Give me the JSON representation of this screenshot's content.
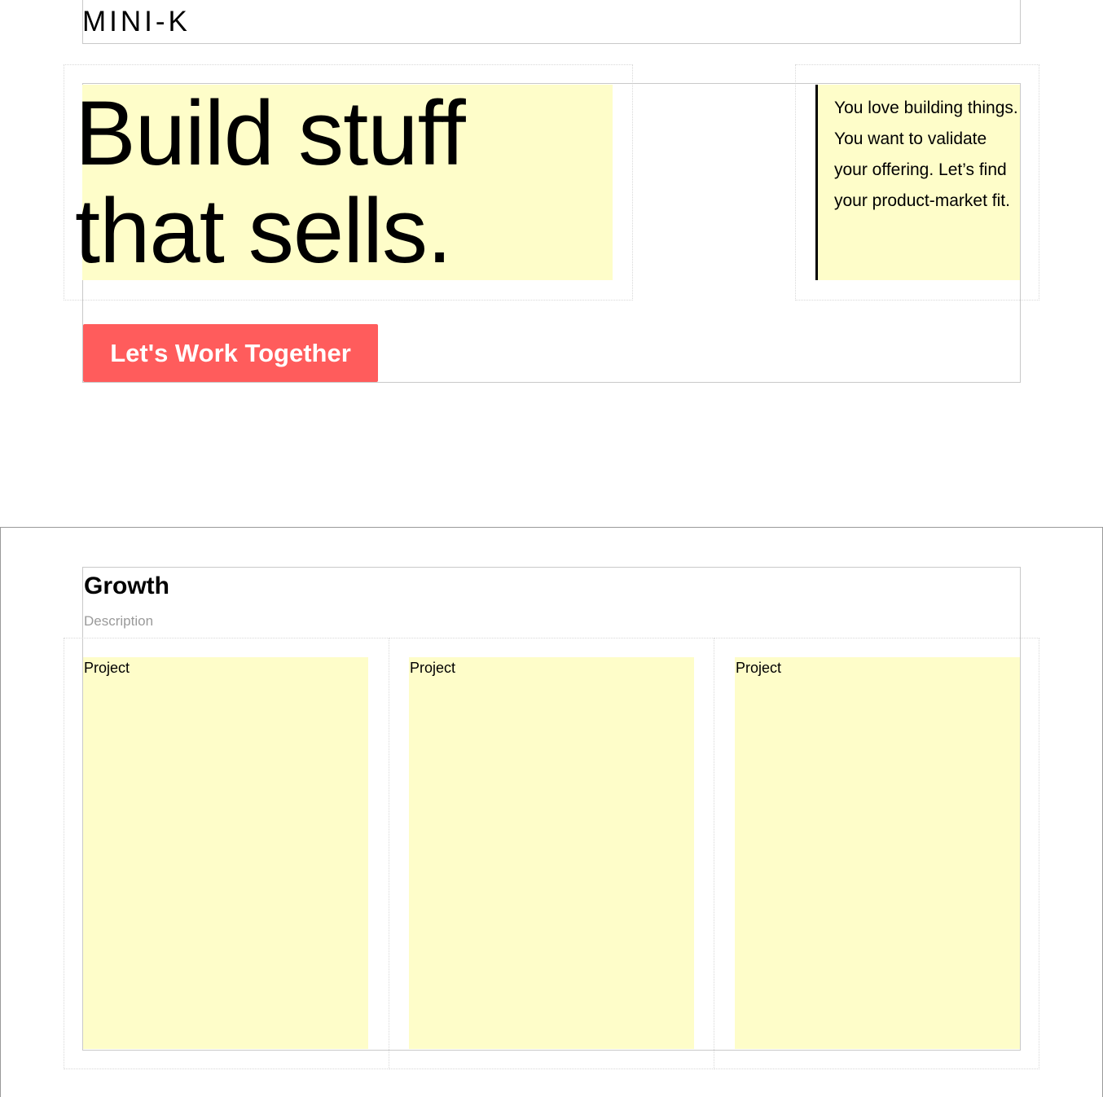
{
  "header": {
    "logo": "MINI-K"
  },
  "hero": {
    "headline_line1": "Build stuff",
    "headline_line2": "that sells.",
    "blurb": "You love building things. You want to validate your offering. Let’s find your product-market fit.",
    "cta_label": "Let's Work Together"
  },
  "section": {
    "title": "Growth",
    "description": "Description",
    "cards": [
      {
        "label": "Project"
      },
      {
        "label": "Project"
      },
      {
        "label": "Project"
      }
    ]
  },
  "colors": {
    "highlight": "#fefdc9",
    "accent": "#ff5c5c"
  }
}
